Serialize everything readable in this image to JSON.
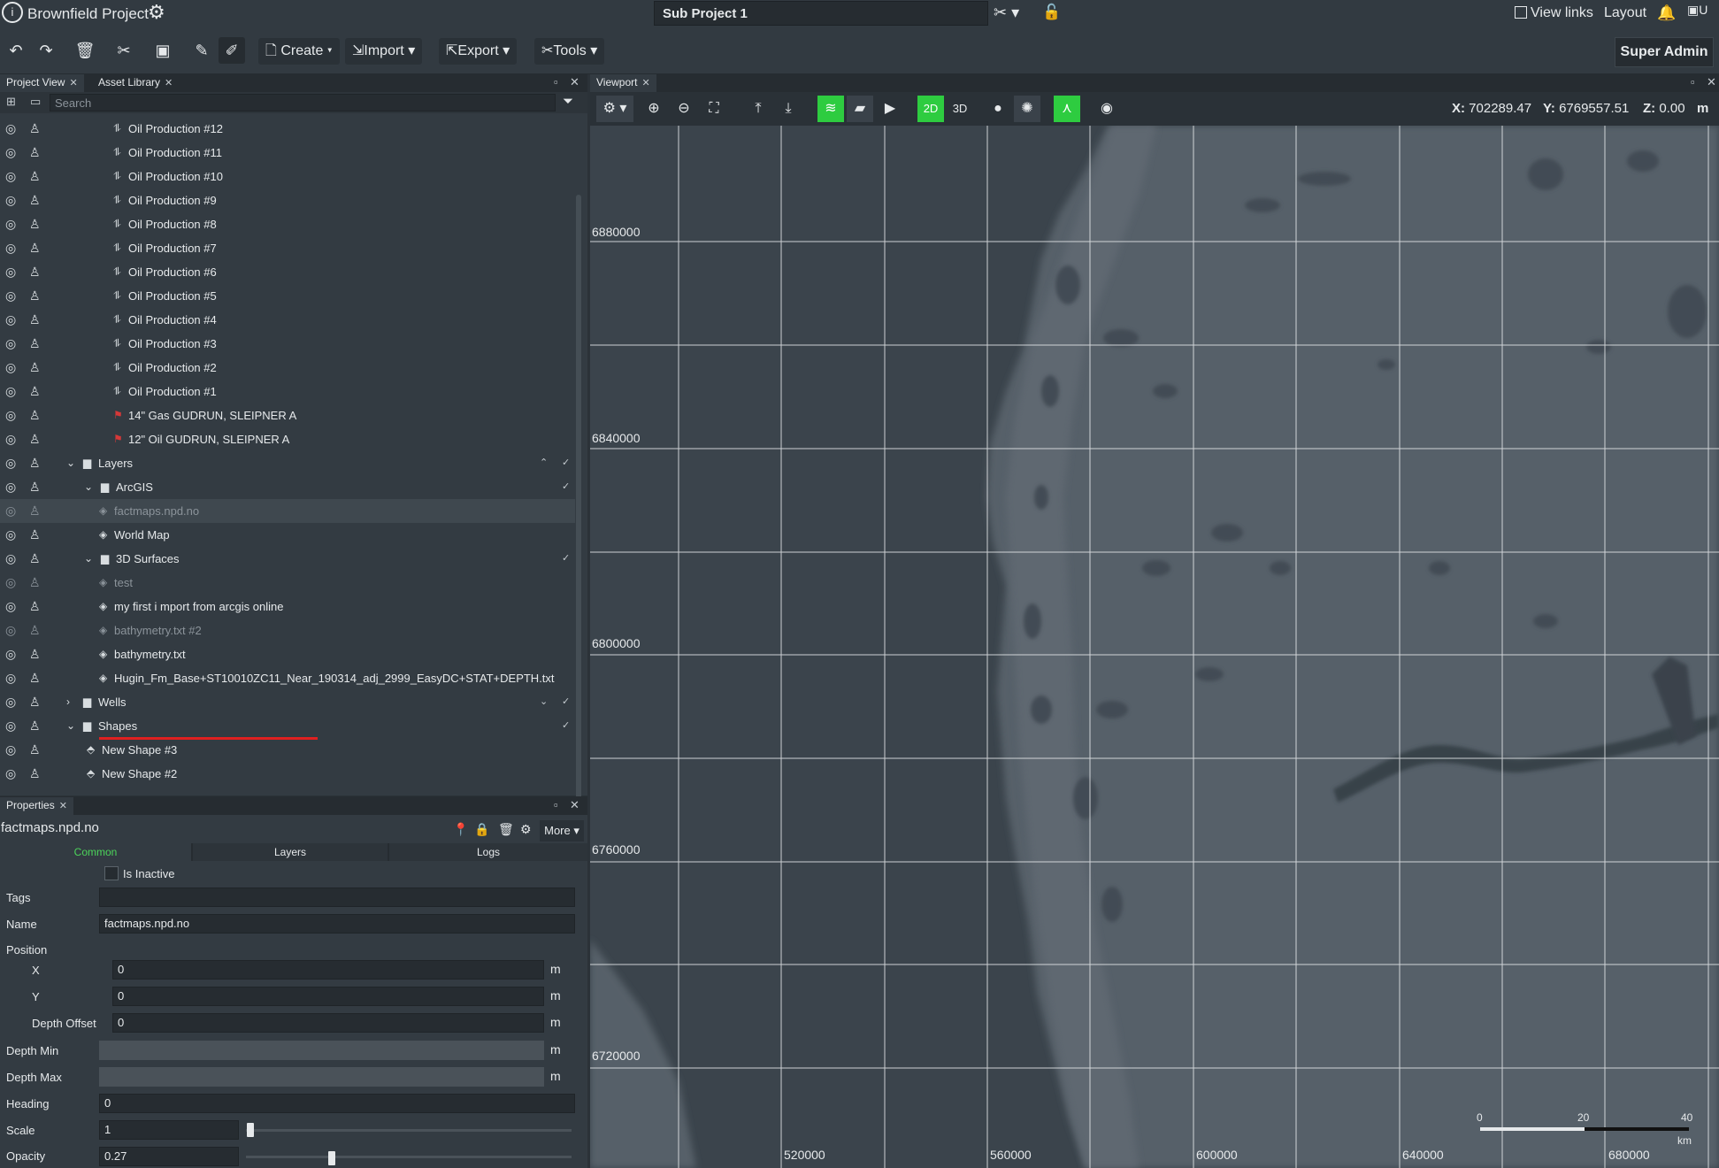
{
  "header": {
    "project_title": "Brownfield Project",
    "subproject": "Sub Project 1",
    "view_links": "View links",
    "layout": "Layout",
    "avatar_alt": "U"
  },
  "toolbar": {
    "create": "Create",
    "import": "Import",
    "export": "Export",
    "tools": "Tools",
    "user_role": "Super Admin"
  },
  "left_panel": {
    "tabs": [
      "Project View",
      "Asset Library"
    ],
    "search_placeholder": "Search"
  },
  "tree": [
    {
      "label": "Oil Production #12",
      "depth": 4,
      "icon": "production-line-icon"
    },
    {
      "label": "Oil Production #11",
      "depth": 4,
      "icon": "production-line-icon"
    },
    {
      "label": "Oil Production #10",
      "depth": 4,
      "icon": "production-line-icon"
    },
    {
      "label": "Oil Production #9",
      "depth": 4,
      "icon": "production-line-icon"
    },
    {
      "label": "Oil Production #8",
      "depth": 4,
      "icon": "production-line-icon"
    },
    {
      "label": "Oil Production #7",
      "depth": 4,
      "icon": "production-line-icon"
    },
    {
      "label": "Oil Production #6",
      "depth": 4,
      "icon": "production-line-icon"
    },
    {
      "label": "Oil Production #5",
      "depth": 4,
      "icon": "production-line-icon"
    },
    {
      "label": "Oil Production #4",
      "depth": 4,
      "icon": "production-line-icon"
    },
    {
      "label": "Oil Production #3",
      "depth": 4,
      "icon": "production-line-icon"
    },
    {
      "label": "Oil Production #2",
      "depth": 4,
      "icon": "production-line-icon"
    },
    {
      "label": "Oil Production #1",
      "depth": 4,
      "icon": "production-line-icon"
    },
    {
      "label": "14\" Gas GUDRUN, SLEIPNER A",
      "depth": 4,
      "icon": "pipeline-icon"
    },
    {
      "label": "12\" Oil GUDRUN, SLEIPNER A",
      "depth": 4,
      "icon": "pipeline-icon"
    },
    {
      "label": "Layers",
      "depth": 1,
      "icon": "folder-icon",
      "expanded": true
    },
    {
      "label": "ArcGIS",
      "depth": 2,
      "icon": "folder-icon",
      "expanded": true
    },
    {
      "label": "factmaps.npd.no",
      "depth": 3,
      "icon": "layer-icon",
      "selected": true,
      "dim": true
    },
    {
      "label": "World Map",
      "depth": 3,
      "icon": "layer-icon"
    },
    {
      "label": "3D Surfaces",
      "depth": 2,
      "icon": "folder-icon",
      "expanded": true
    },
    {
      "label": "test",
      "depth": 3,
      "icon": "layer-icon",
      "dim": true
    },
    {
      "label": "my first i mport from arcgis online",
      "depth": 3,
      "icon": "layer-icon"
    },
    {
      "label": "bathymetry.txt #2",
      "depth": 3,
      "icon": "layer-icon",
      "dim": true
    },
    {
      "label": "bathymetry.txt",
      "depth": 3,
      "icon": "layer-icon"
    },
    {
      "label": "Hugin_Fm_Base+ST10010ZC11_Near_190314_adj_2999_EasyDC+STAT+DEPTH.txt",
      "depth": 3,
      "icon": "layer-icon"
    },
    {
      "label": "Wells",
      "depth": 1,
      "icon": "folder-icon",
      "expanded": false
    },
    {
      "label": "Shapes",
      "depth": 1,
      "icon": "folder-icon",
      "expanded": true
    },
    {
      "label": "New Shape #3",
      "depth": 2,
      "icon": "shape-icon"
    },
    {
      "label": "New Shape #2",
      "depth": 2,
      "icon": "shape-icon"
    }
  ],
  "properties": {
    "tab": "Properties",
    "title": "factmaps.npd.no",
    "more": "More",
    "subtabs": [
      "Common",
      "Layers",
      "Logs"
    ],
    "is_inactive_label": "Is Inactive",
    "tags_label": "Tags",
    "tags_value": "",
    "name_label": "Name",
    "name_value": "factmaps.npd.no",
    "position_label": "Position",
    "x_label": "X",
    "x_value": "0",
    "y_label": "Y",
    "y_value": "0",
    "depth_offset_label": "Depth Offset",
    "depth_offset_value": "0",
    "depth_min_label": "Depth Min",
    "depth_max_label": "Depth Max",
    "heading_label": "Heading",
    "heading_value": "0",
    "scale_label": "Scale",
    "scale_value": "1",
    "opacity_label": "Opacity",
    "opacity_value": "0.27",
    "unit": "m"
  },
  "viewport": {
    "tab": "Viewport",
    "mode_2d": "2D",
    "mode_3d": "3D",
    "x_label": "X:",
    "x_value": "702289.47",
    "y_label": "Y:",
    "y_value": "6769557.51",
    "z_label": "Z:",
    "z_value": "0.00",
    "unit": "m",
    "northings": [
      "6880000",
      "6840000",
      "6800000",
      "6760000",
      "6720000"
    ],
    "eastings": [
      "520000",
      "560000",
      "600000",
      "640000",
      "680000"
    ],
    "scalebar_labels": [
      "0",
      "20",
      "40"
    ],
    "scalebar_unit": "km"
  },
  "colors": {
    "accent_green": "#2ecc40",
    "highlight_red": "#e02020"
  }
}
